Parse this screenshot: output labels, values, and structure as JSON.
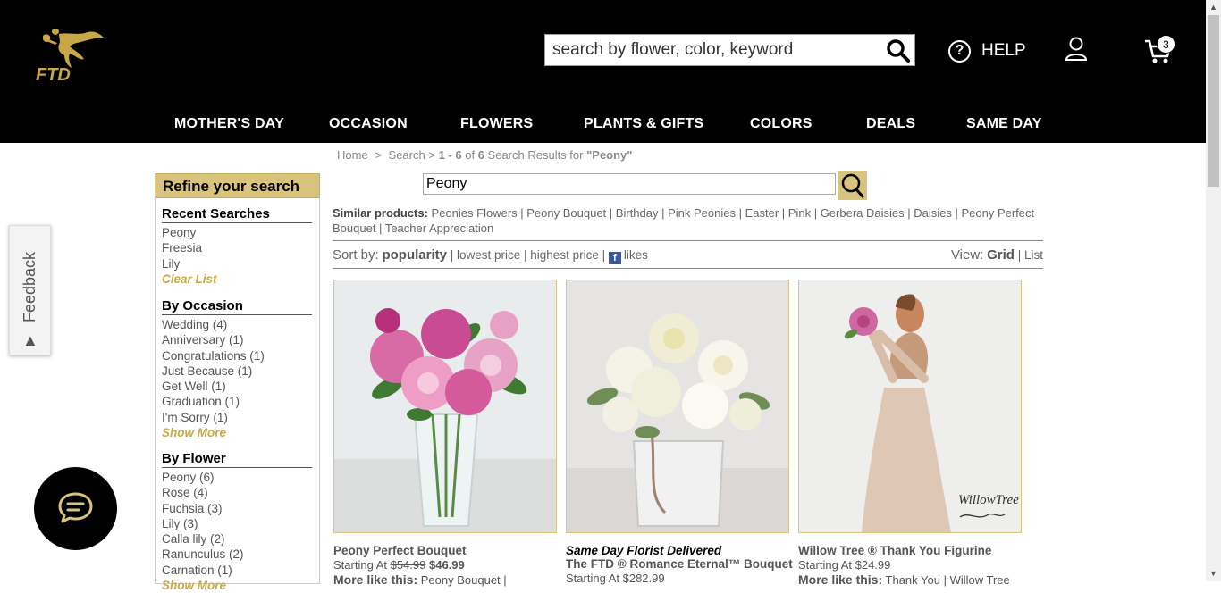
{
  "header": {
    "logo_text": "FTD",
    "search_placeholder": "search by flower, color, keyword",
    "help_label": "HELP",
    "cart_count": "3"
  },
  "nav": [
    "MOTHER'S DAY",
    "OCCASION",
    "FLOWERS",
    "PLANTS & GIFTS",
    "COLORS",
    "DEALS",
    "SAME DAY"
  ],
  "breadcrumb": {
    "home": "Home",
    "sep1": ">",
    "search": "Search",
    "sep2": ">",
    "range": "1 - 6",
    "of": "of",
    "total": "6",
    "results_for": "Search Results for",
    "query": "\"Peony\""
  },
  "sidebar": {
    "title": "Refine your search",
    "recent": {
      "title": "Recent Searches",
      "items": [
        "Peony",
        "Freesia",
        "Lily"
      ],
      "clear": "Clear List"
    },
    "occasion": {
      "title": "By Occasion",
      "items": [
        "Wedding (4)",
        "Anniversary (1)",
        "Congratulations (1)",
        "Just Because (1)",
        "Get Well (1)",
        "Graduation (1)",
        "I'm Sorry (1)"
      ],
      "more": "Show More"
    },
    "flower": {
      "title": "By Flower",
      "items": [
        "Peony (6)",
        "Rose (4)",
        "Fuchsia (3)",
        "Lily (3)",
        "Calla lily (2)",
        "Ranunculus (2)",
        "Carnation (1)"
      ],
      "more": "Show More"
    }
  },
  "feedback_label": "Feedback",
  "main_search_value": "Peony",
  "similar": {
    "label": "Similar products:",
    "items": [
      "Peonies Flowers",
      "Peony Bouquet",
      "Birthday",
      "Pink Peonies",
      "Easter",
      "Pink",
      "Gerbera Daisies",
      "Daisies",
      "Peony Perfect Bouquet",
      "Teacher Appreciation"
    ]
  },
  "sort": {
    "label": "Sort by:",
    "active": "popularity",
    "options": [
      "lowest price",
      "highest price"
    ],
    "likes": "likes"
  },
  "view": {
    "label": "View:",
    "active": "Grid",
    "other": "List"
  },
  "products": [
    {
      "name": "Peony Perfect Bouquet",
      "price_prefix": "Starting At",
      "old_price": "$54.99",
      "price": "$46.99",
      "more_label": "More like this:",
      "more_links": "Peony Bouquet |"
    },
    {
      "tag": "Same Day Florist Delivered",
      "name": "The FTD ® Romance Eternal™ Bouquet",
      "price_prefix": "Starting At",
      "price": "$282.99"
    },
    {
      "name": "Willow Tree ® Thank You Figurine",
      "price_prefix": "Starting At",
      "price": "$24.99",
      "more_label": "More like this:",
      "more_links": "Thank You | Willow Tree",
      "img_caption": "WillowTree"
    }
  ],
  "colors": {
    "gold": "#d8c47c",
    "header_bg": "#000000",
    "link_gold": "#c8a94a"
  }
}
